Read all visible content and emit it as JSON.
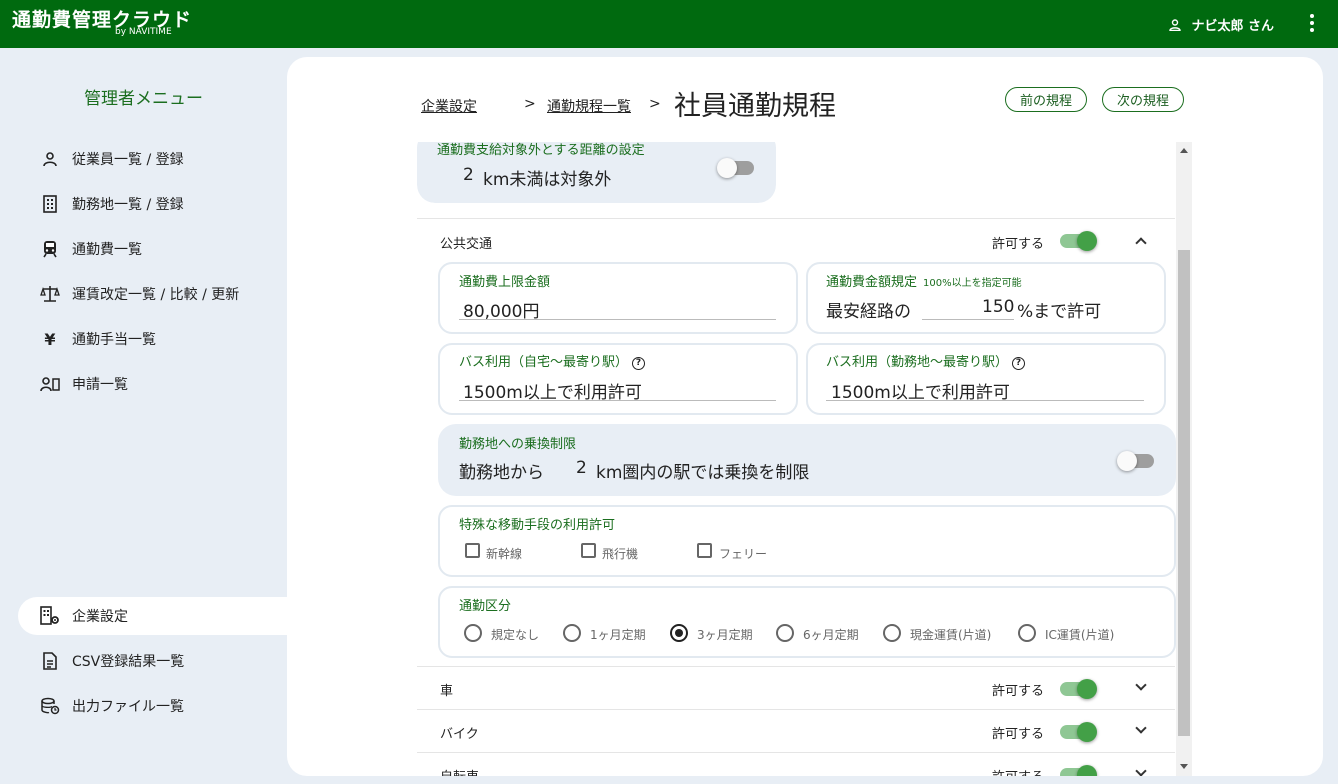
{
  "header": {
    "app_name": "通勤費管理クラウド",
    "app_sub": "by NAVITIME",
    "user_name": "ナビ太郎 さん"
  },
  "sidebar": {
    "title": "管理者メニュー",
    "items": [
      {
        "label": "従業員一覧 / 登録",
        "icon": "person-icon"
      },
      {
        "label": "勤務地一覧 / 登録",
        "icon": "building-icon"
      },
      {
        "label": "通勤費一覧",
        "icon": "train-icon"
      },
      {
        "label": "運賃改定一覧 / 比較 / 更新",
        "icon": "scale-icon"
      },
      {
        "label": "通勤手当一覧",
        "icon": "yen-icon"
      },
      {
        "label": "申請一覧",
        "icon": "application-icon"
      }
    ],
    "bottom_items": [
      {
        "label": "企業設定",
        "icon": "company-settings-icon",
        "active": true
      },
      {
        "label": "CSV登録結果一覧",
        "icon": "csv-file-icon"
      },
      {
        "label": "出力ファイル一覧",
        "icon": "output-file-icon"
      }
    ]
  },
  "breadcrumb": {
    "company": "企業設定",
    "sep1": ">",
    "rules_list": "通勤規程一覧",
    "sep2": ">"
  },
  "page_title": "社員通勤規程",
  "nav_buttons": {
    "prev": "前の規程",
    "next": "次の規程"
  },
  "distance": {
    "label": "通勤費支給対象外とする距離の設定",
    "value": "2",
    "suffix": "km未満は対象外",
    "enabled": false
  },
  "public_transport": {
    "label": "公共交通",
    "allow_label": "許可する",
    "enabled": true,
    "limit_label": "通勤費上限金額",
    "limit_value": "80,000円",
    "rule_label": "通勤費金額規定",
    "rule_note": "100%以上を指定可能",
    "rule_prefix": "最安経路の",
    "rule_value": "150",
    "rule_suffix": "%まで許可",
    "bus_home_label": "バス利用（自宅～最寄り駅）",
    "bus_home_value": "1500m以上で利用許可",
    "bus_work_label": "バス利用（勤務地～最寄り駅）",
    "bus_work_value": "1500m以上で利用許可",
    "help_glyph": "?",
    "transfer_label": "勤務地への乗換制限",
    "transfer_prefix": "勤務地から",
    "transfer_value": "2",
    "transfer_suffix": "km圏内の駅では乗換を制限",
    "transfer_enabled": false,
    "special_label": "特殊な移動手段の利用許可",
    "special_options": [
      "新幹線",
      "飛行機",
      "フェリー"
    ],
    "category_label": "通勤区分",
    "category_options": [
      "規定なし",
      "1ヶ月定期",
      "3ヶ月定期",
      "6ヶ月定期",
      "現金運賃(片道)",
      "IC運賃(片道)"
    ],
    "category_selected": "3ヶ月定期"
  },
  "sections": [
    {
      "label": "車",
      "allow_label": "許可する",
      "enabled": true
    },
    {
      "label": "バイク",
      "allow_label": "許可する",
      "enabled": true
    },
    {
      "label": "自転車",
      "allow_label": "許可する",
      "enabled": true
    }
  ],
  "colors": {
    "header": "#006a0f",
    "accent": "#1b6e1f",
    "toggle_on": "#43a047"
  }
}
